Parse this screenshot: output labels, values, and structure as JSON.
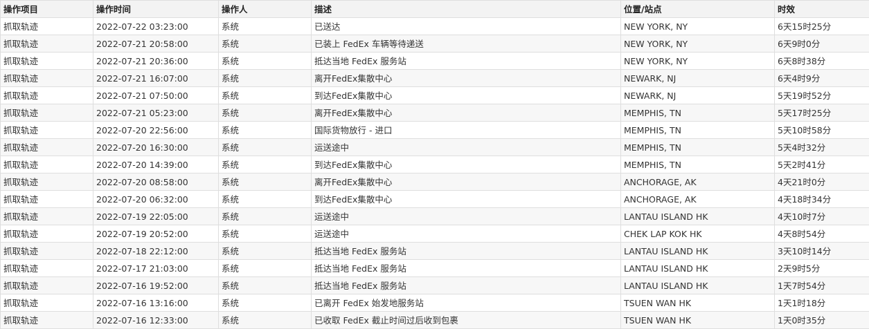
{
  "table": {
    "headers": [
      "操作项目",
      "操作时间",
      "操作人",
      "描述",
      "位置/站点",
      "时效"
    ],
    "rows": [
      [
        "抓取轨迹",
        "2022-07-22 03:23:00",
        "系统",
        "已送达",
        "NEW YORK, NY",
        "6天15时25分"
      ],
      [
        "抓取轨迹",
        "2022-07-21 20:58:00",
        "系统",
        "已装上 FedEx 车辆等待递送",
        "NEW YORK, NY",
        "6天9时0分"
      ],
      [
        "抓取轨迹",
        "2022-07-21 20:36:00",
        "系统",
        "抵达当地 FedEx 服务站",
        "NEW YORK, NY",
        "6天8时38分"
      ],
      [
        "抓取轨迹",
        "2022-07-21 16:07:00",
        "系统",
        "离开FedEx集散中心",
        "NEWARK, NJ",
        "6天4时9分"
      ],
      [
        "抓取轨迹",
        "2022-07-21 07:50:00",
        "系统",
        "到达FedEx集散中心",
        "NEWARK, NJ",
        "5天19时52分"
      ],
      [
        "抓取轨迹",
        "2022-07-21 05:23:00",
        "系统",
        "离开FedEx集散中心",
        "MEMPHIS, TN",
        "5天17时25分"
      ],
      [
        "抓取轨迹",
        "2022-07-20 22:56:00",
        "系统",
        "国际货物放行 - 进口",
        "MEMPHIS, TN",
        "5天10时58分"
      ],
      [
        "抓取轨迹",
        "2022-07-20 16:30:00",
        "系统",
        "运送途中",
        "MEMPHIS, TN",
        "5天4时32分"
      ],
      [
        "抓取轨迹",
        "2022-07-20 14:39:00",
        "系统",
        "到达FedEx集散中心",
        "MEMPHIS, TN",
        "5天2时41分"
      ],
      [
        "抓取轨迹",
        "2022-07-20 08:58:00",
        "系统",
        "离开FedEx集散中心",
        "ANCHORAGE, AK",
        "4天21时0分"
      ],
      [
        "抓取轨迹",
        "2022-07-20 06:32:00",
        "系统",
        "到达FedEx集散中心",
        "ANCHORAGE, AK",
        "4天18时34分"
      ],
      [
        "抓取轨迹",
        "2022-07-19 22:05:00",
        "系统",
        "运送途中",
        "LANTAU ISLAND HK",
        "4天10时7分"
      ],
      [
        "抓取轨迹",
        "2022-07-19 20:52:00",
        "系统",
        "运送途中",
        "CHEK LAP KOK HK",
        "4天8时54分"
      ],
      [
        "抓取轨迹",
        "2022-07-18 22:12:00",
        "系统",
        "抵达当地 FedEx 服务站",
        "LANTAU ISLAND HK",
        "3天10时14分"
      ],
      [
        "抓取轨迹",
        "2022-07-17 21:03:00",
        "系统",
        "抵达当地 FedEx 服务站",
        "LANTAU ISLAND HK",
        "2天9时5分"
      ],
      [
        "抓取轨迹",
        "2022-07-16 19:52:00",
        "系统",
        "抵达当地 FedEx 服务站",
        "LANTAU ISLAND HK",
        "1天7时54分"
      ],
      [
        "抓取轨迹",
        "2022-07-16 13:16:00",
        "系统",
        "已离开 FedEx 始发地服务站",
        "TSUEN WAN HK",
        "1天1时18分"
      ],
      [
        "抓取轨迹",
        "2022-07-16 12:33:00",
        "系统",
        "已收取 FedEx 截止时间过后收到包裹",
        "TSUEN WAN HK",
        "1天0时35分"
      ]
    ]
  }
}
